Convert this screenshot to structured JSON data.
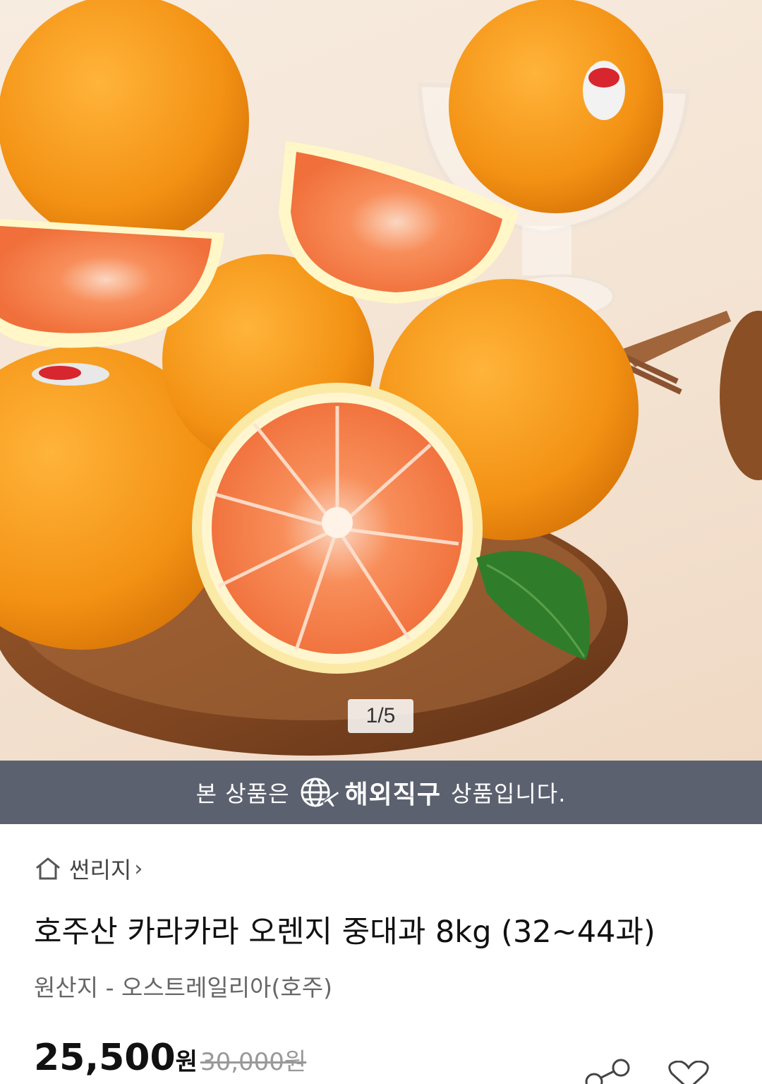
{
  "gallery": {
    "counter": "1/5"
  },
  "overseas_banner": {
    "prefix": "본 상품은",
    "brand": "해외직구",
    "suffix": "상품입니다.",
    "icon": "globe-plane-icon"
  },
  "breadcrumb": {
    "icon": "home-icon",
    "seller": "썬리지",
    "chevron": "›"
  },
  "product": {
    "title": "호주산 카라카라 오렌지 중대과 8kg (32~44과)",
    "origin": "원산지 - 오스트레일리아(호주)"
  },
  "price": {
    "sale": "25,500",
    "unit": "원",
    "original": "30,000원"
  },
  "actions": {
    "share_icon": "share-icon",
    "like_icon": "heart-icon"
  },
  "colors": {
    "banner": "#5c6170",
    "orange": "#f39a18",
    "flesh": "#f27a48"
  }
}
